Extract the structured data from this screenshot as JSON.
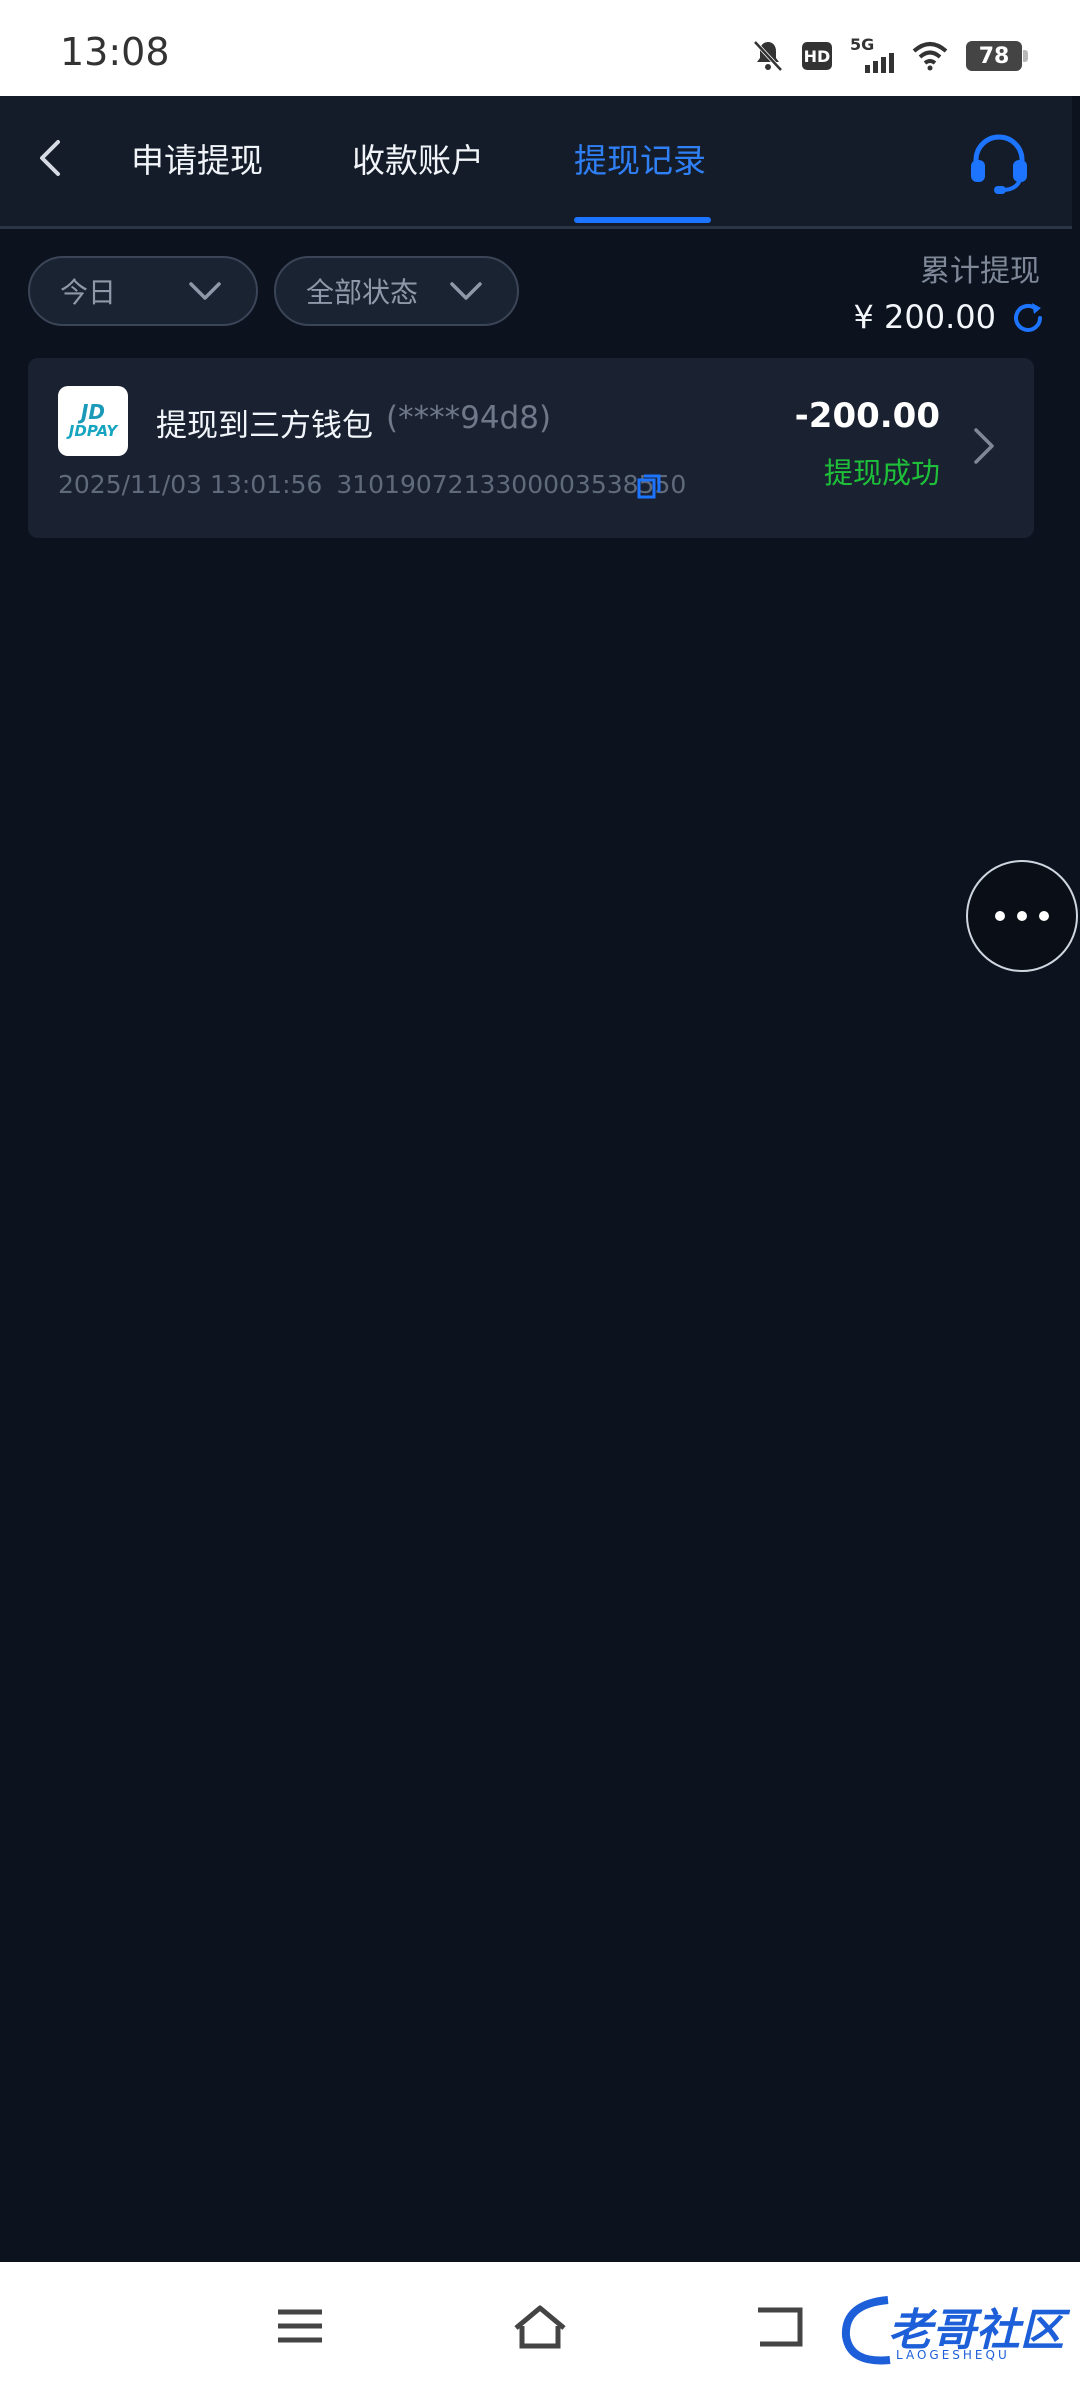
{
  "status_bar": {
    "time": "13:08",
    "hd_label": "HD",
    "network_label": "5G",
    "battery": "78"
  },
  "header": {
    "tabs": [
      {
        "label": "申请提现",
        "active": false
      },
      {
        "label": "收款账户",
        "active": false
      },
      {
        "label": "提现记录",
        "active": true
      }
    ],
    "accent_color": "#1c74ff"
  },
  "filters": {
    "date": "今日",
    "status": "全部状态"
  },
  "summary": {
    "label": "累计提现",
    "amount": "¥ 200.00"
  },
  "records": [
    {
      "logo_word": "JDPAY",
      "title": "提现到三方钱包",
      "masked_account": "(****94d8)",
      "datetime": "2025/11/03 13:01:56",
      "transaction_id": "3101907213300003538550",
      "amount": "-200.00",
      "status": "提现成功",
      "status_color": "#1ec03a"
    }
  ],
  "watermark": {
    "text": "老哥社区",
    "sub": "LAOGESHEQU"
  }
}
